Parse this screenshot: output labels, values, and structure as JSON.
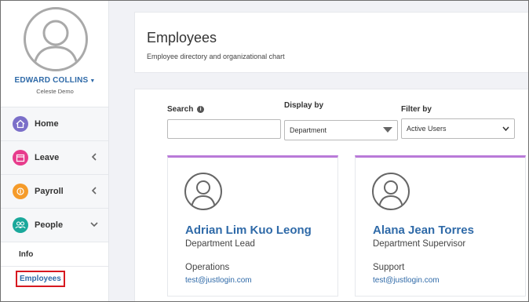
{
  "user": {
    "name": "EDWARD COLLINS",
    "caret": "▼",
    "organization": "Celeste Demo"
  },
  "nav": {
    "items": [
      {
        "label": "Home",
        "icon": "home-icon",
        "color": "#7b6fc9"
      },
      {
        "label": "Leave",
        "icon": "calendar-icon",
        "color": "#e73c8c"
      },
      {
        "label": "Payroll",
        "icon": "money-icon",
        "color": "#f59b2a"
      },
      {
        "label": "People",
        "icon": "people-icon",
        "color": "#1aa89b"
      }
    ],
    "sub_items": [
      {
        "label": "Info"
      },
      {
        "label": "Employees"
      }
    ]
  },
  "header": {
    "title": "Employees",
    "subtitle": "Employee directory and organizational chart"
  },
  "filters": {
    "search_label": "Search",
    "search_value": "",
    "info_glyph": "i",
    "display_label": "Display by",
    "display_value": "Department",
    "filter_label": "Filter by",
    "filter_value": "Active Users"
  },
  "employees": [
    {
      "name": "Adrian Lim Kuo Leong",
      "role": "Department Lead",
      "department": "Operations",
      "email": "test@justlogin.com"
    },
    {
      "name": "Alana Jean Torres",
      "role": "Department Supervisor",
      "department": "Support",
      "email": "test@justlogin.com"
    }
  ],
  "colors": {
    "accent_blue": "#2f6aa8",
    "card_top_border": "#b97ad8",
    "highlight_red": "#d71920"
  }
}
